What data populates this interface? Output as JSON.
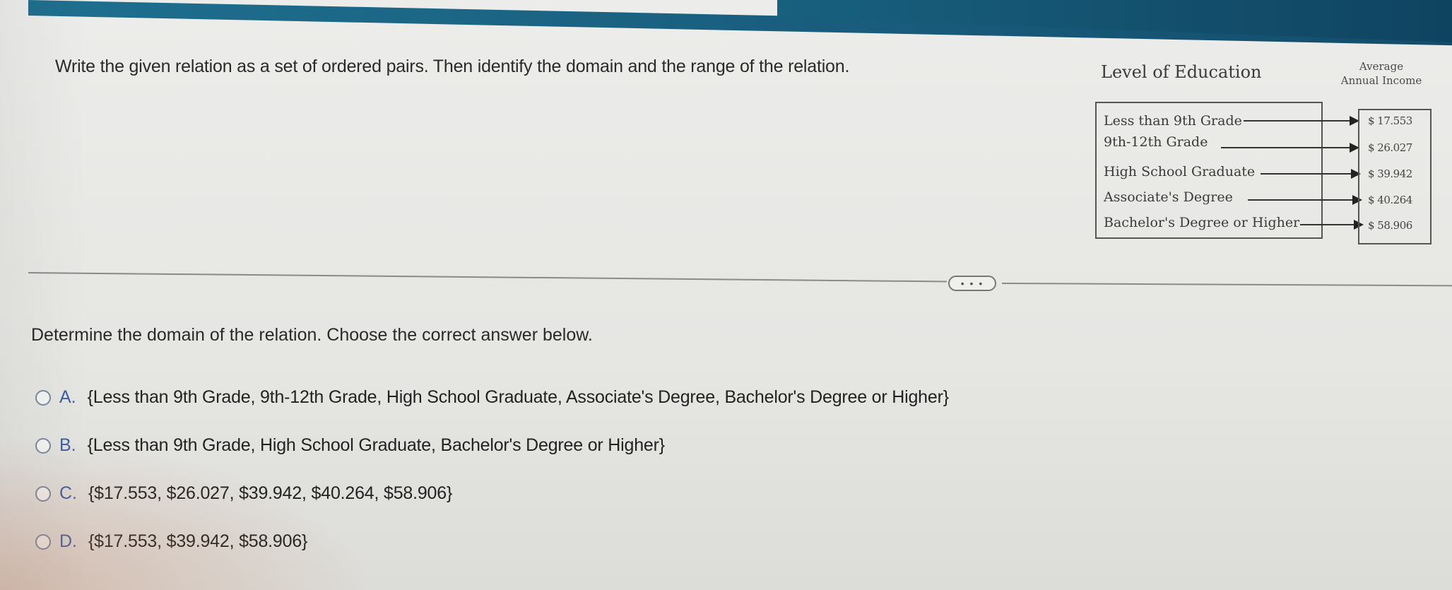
{
  "header": {
    "instruction": "Write the given relation as a set of ordered pairs. Then identify the domain and the range of the relation."
  },
  "figure": {
    "left_title": "Level of Education",
    "right_title_line1": "Average",
    "right_title_line2": "Annual Income",
    "domain_items": [
      "Less than 9th Grade",
      "9th-12th Grade",
      "High School Graduate",
      "Associate's Degree",
      "Bachelor's Degree or Higher"
    ],
    "range_items": [
      "$ 17.553",
      "$ 26.027",
      "$ 39.942",
      "$ 40.264",
      "$ 58.906"
    ]
  },
  "divider": {
    "more_label": "• • •"
  },
  "question": {
    "prompt": "Determine the domain of the relation. Choose the correct answer below.",
    "options": [
      {
        "letter": "A.",
        "text": "{Less than 9th Grade, 9th-12th Grade, High School Graduate, Associate's Degree, Bachelor's Degree or Higher}"
      },
      {
        "letter": "B.",
        "text": "{Less than 9th Grade, High School Graduate, Bachelor's Degree or Higher}"
      },
      {
        "letter": "C.",
        "text": "{$17.553, $26.027, $39.942, $40.264, $58.906}"
      },
      {
        "letter": "D.",
        "text": "{$17.553, $39.942, $58.906}"
      }
    ]
  },
  "colors": {
    "header_bar": "#1a5f80",
    "option_letter": "#3d5ea0"
  }
}
